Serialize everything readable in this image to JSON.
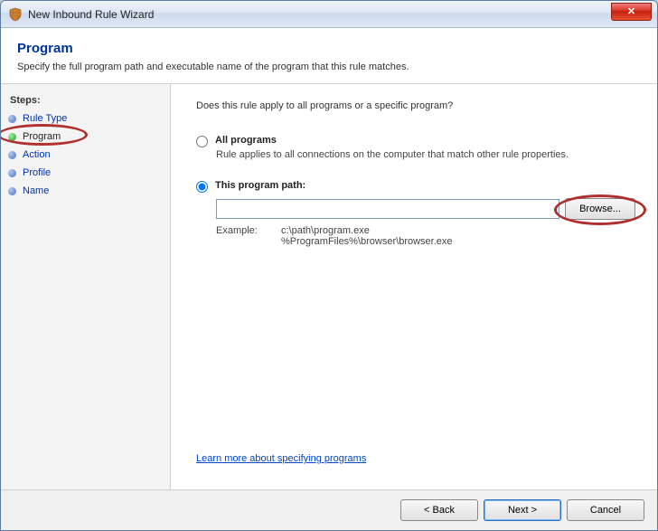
{
  "window": {
    "title": "New Inbound Rule Wizard",
    "close_glyph": "✕"
  },
  "header": {
    "title": "Program",
    "subtitle": "Specify the full program path and executable name of the program that this rule matches."
  },
  "sidebar": {
    "heading": "Steps:",
    "items": [
      {
        "label": "Rule Type",
        "state": "visited"
      },
      {
        "label": "Program",
        "state": "current"
      },
      {
        "label": "Action",
        "state": "pending"
      },
      {
        "label": "Profile",
        "state": "pending"
      },
      {
        "label": "Name",
        "state": "pending"
      }
    ]
  },
  "main": {
    "question": "Does this rule apply to all programs or a specific program?",
    "option_all": {
      "label": "All programs",
      "desc": "Rule applies to all connections on the computer that match other rule properties."
    },
    "option_path": {
      "label": "This program path:",
      "value": "",
      "browse": "Browse...",
      "example_label": "Example:",
      "example_values": "c:\\path\\program.exe\n%ProgramFiles%\\browser\\browser.exe"
    },
    "learn_link": "Learn more about specifying programs"
  },
  "footer": {
    "back": "< Back",
    "next": "Next >",
    "cancel": "Cancel"
  }
}
